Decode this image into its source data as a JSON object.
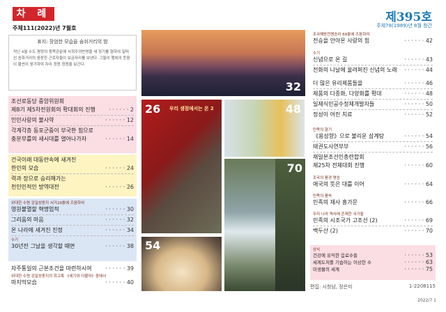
{
  "header": {
    "label": "차 례",
    "left_issue": "주체111(2022)년 7월호",
    "right_issue": "제395호",
    "right_sub": "주체78(1989)년 8월 창간"
  },
  "intro": {
    "title": "표지: 장엄한 모습을 숨쉬거리의 밤",
    "body": "직난 4월 수도 평양의 동쪽관문에 사회주의번영을 새 정기를 형하여 일떠선 송화거리의 웅장한 근로자들이 보금자리를 보낸다. 그들이 행복의 웃음이 불씬이 웅가하여 자리 정원 정원을 보간다."
  },
  "sec1": {
    "caption": "",
    "items": [
      {
        "t": "조선로동당 중앙위원회",
        "p": ""
      },
      {
        "t": "제8기 제5차전원회의 확대회의 진행",
        "p": "2"
      },
      {
        "t": "인민사랑의 불사약",
        "p": "12"
      },
      {
        "t": "각계각층 동포군중이 부국한 힘으로",
        "p": ""
      },
      {
        "t": "충분부를의 새시대를 열어나가자",
        "p": "14"
      }
    ]
  },
  "sec2": {
    "items": [
      {
        "t": "건국이래 대동란속에 새겨진",
        "p": ""
      },
      {
        "t": "한민의 모습",
        "p": "24"
      },
      {
        "t": "력과 장으로 승리해가는",
        "p": ""
      },
      {
        "t": "천인민적인 방역대전",
        "p": "26"
      }
    ]
  },
  "sec3": {
    "caption": "위대한 수령 김일성동지 서거28돐에 즈음하여",
    "items": [
      {
        "t": "영원불멸할 혁명업적",
        "p": "30"
      },
      {
        "t": "그리움의 마음",
        "p": "32"
      },
      {
        "t": "온 나라에 새겨진 진정",
        "p": "34"
      }
    ]
  },
  "sec4": {
    "caption": "수기",
    "items": [
      {
        "t": "30년전 그날을 생각할 때면",
        "p": "38"
      },
      {
        "t": "자주통일의 근본조건을 마련하시여",
        "p": "39"
      }
    ]
  },
  "sec5": {
    "caption": "위대한 수령 김일성동지의 회고록 《세기와 더불어》중에서",
    "items": [
      {
        "t": "마지막모습",
        "p": "40"
      }
    ]
  },
  "photos": {
    "n32": "32",
    "n26": "26",
    "n48": "48",
    "n70": "70",
    "n54": "54",
    "banner26": "우리 생정에서는 온 2"
  },
  "right": {
    "sec_a": {
      "caption": "조국해방전쟁승리 69돐에 즈음하여",
      "items": [
        {
          "t": "전승을 안아온 사랑의 힘",
          "p": "42"
        }
      ]
    },
    "sec_b": {
      "caption": "수기",
      "items": [
        {
          "t": "신념으로 온 길",
          "p": "43"
        },
        {
          "t": "전화의 나날에 울려퍼진 신념의 노래",
          "p": "44"
        }
      ]
    },
    "sec_c": {
      "items": [
        {
          "t": "더 많은 유리제품들을",
          "p": "46"
        },
        {
          "t": "제품의 다종화, 다양화를 확대",
          "p": "48"
        },
        {
          "t": "일제식민공수정체개발자들",
          "p": "50"
        },
        {
          "t": "정성이 어린 치료",
          "p": "52"
        }
      ]
    },
    "sec_d": {
      "caption": "민족의 향기",
      "items": [
        {
          "t": "《용성향》으로 불리운 삼계탕",
          "p": "54"
        },
        {
          "t": "태권도사연부부",
          "p": "56"
        },
        {
          "t": "재일본조선인총련합회",
          "p": ""
        },
        {
          "t": "제25차 전체대회 진행",
          "p": "60"
        }
      ]
    },
    "sec_e": {
      "caption": "조국의 풍경 명승",
      "items": [
        {
          "t": "애국의 뜻은 대를 이어",
          "p": "64"
        }
      ]
    },
    "sec_f": {
      "caption": "민족의 풍속",
      "items": [
        {
          "t": "민족의 재사 흥가문",
          "p": "66"
        }
      ]
    },
    "sec_g": {
      "caption": "우리 나라 역사에 존재한 국가들",
      "items": [
        {
          "t": "민족의 시조국가 고조선 (2)",
          "p": "69"
        },
        {
          "t": "백두산 (2)",
          "p": "70"
        }
      ]
    },
    "sec_h": {
      "caption": "상식",
      "items": [
        {
          "t": "건강에 유익한 음료수들",
          "p": "53"
        },
        {
          "t": "세계도처를 기습하는 이상한 수",
          "p": "63"
        },
        {
          "t": "미생물의 세계",
          "p": "75"
        }
      ]
    },
    "footer_editor": "편집: 시청남, 정은미",
    "footer_code": "1-2208115",
    "page_foot": "2022/7  1"
  }
}
